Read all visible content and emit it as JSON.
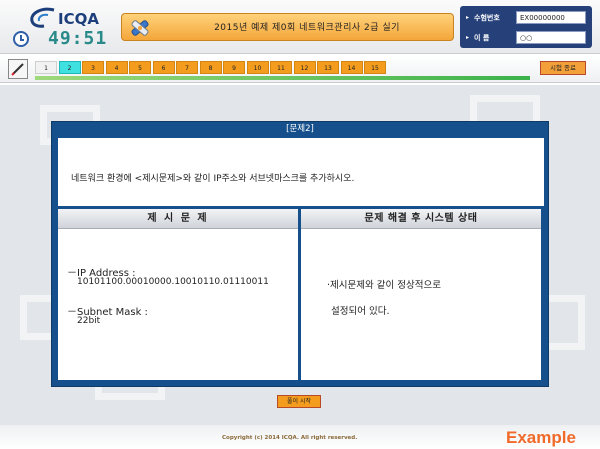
{
  "header": {
    "logo_text": "ICQA",
    "timer": "49:51",
    "exam_title": "2015년 예제 제0회 네트워크관리사 2급 실기",
    "candidate": {
      "number_label": "수험번호",
      "number_value": "EX00000000",
      "name_label": "이      름",
      "name_value": "○○"
    }
  },
  "toolbar": {
    "question_tabs": [
      "1",
      "2",
      "3",
      "4",
      "5",
      "6",
      "7",
      "8",
      "9",
      "10",
      "11",
      "12",
      "13",
      "14",
      "15"
    ],
    "current_question": "2",
    "end_button": "시험 종료"
  },
  "question": {
    "label": "[문제2]",
    "text": "네트워크 환경에 <제시문제>와 같이 IP주소와 서브넷마스크를 추가하시오.",
    "left_header": "제 시 문 제",
    "right_header": "문제 해결 후 시스템 상태",
    "ip_label": "－IP Address :",
    "ip_value": "10101100.00010000.10010110.01110011",
    "mask_label": "－Subnet Mask :",
    "mask_value": "22bit",
    "state_line1": "·제시문제와 같이 정상적으로",
    "state_line2": "설정되어 있다."
  },
  "solve_button": "풀이 시작",
  "footer": {
    "copyright": "Copyright (c) 2014 ICQA.  All right reserved."
  },
  "watermark": "Example"
}
